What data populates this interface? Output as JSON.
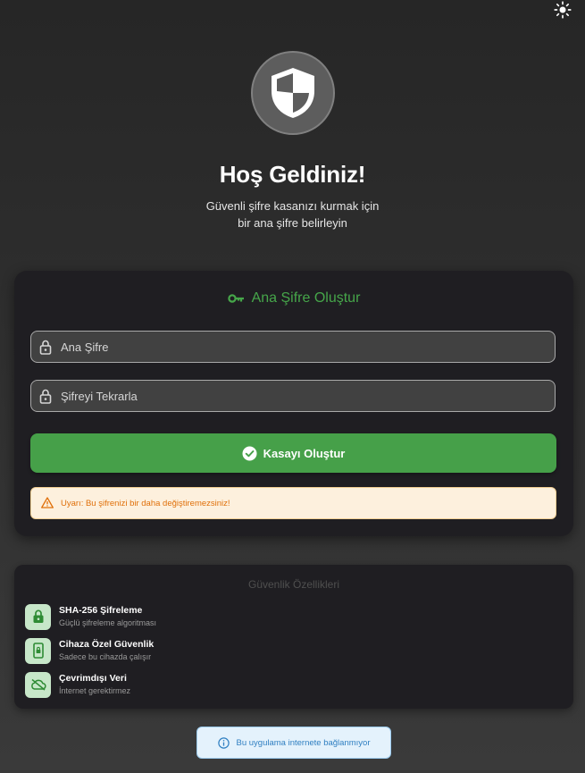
{
  "header": {
    "theme_toggle_icon": "sun-icon"
  },
  "hero": {
    "icon": "shield-icon",
    "title": "Hoş Geldiniz!",
    "subtitle_line1": "Güvenli şifre kasanızı kurmak için",
    "subtitle_line2": "bir ana şifre belirleyin"
  },
  "setup_card": {
    "title_icon": "key-icon",
    "title": "Ana Şifre Oluştur",
    "master_password": {
      "placeholder": "Ana Şifre",
      "value": "",
      "icon": "lock-icon"
    },
    "confirm_password": {
      "placeholder": "Şifreyi Tekrarla",
      "value": "",
      "icon": "lock-icon"
    },
    "create_button": {
      "label": "Kasayı Oluştur",
      "icon": "check-circle-icon"
    },
    "warning": {
      "icon": "warning-icon",
      "text": "Uyarı: Bu şifrenizi bir daha değiştiremezsiniz!"
    }
  },
  "features": {
    "title": "Güvenlik Özellikleri",
    "items": [
      {
        "icon": "lock-icon",
        "title": "SHA-256 Şifreleme",
        "description": "Güçlü şifreleme algoritması"
      },
      {
        "icon": "phone-lock-icon",
        "title": "Cihaza Özel Güvenlik",
        "description": "Sadece bu cihazda çalışır"
      },
      {
        "icon": "cloud-off-icon",
        "title": "Çevrimdışı Veri",
        "description": "İnternet gerektirmez"
      }
    ]
  },
  "offline_notice": {
    "icon": "info-icon",
    "text": "Bu uygulama internete bağlanmıyor"
  },
  "colors": {
    "accent_green": "#46a049",
    "warning_orange": "#e0700a",
    "info_blue": "#2f7fc1",
    "card_background": "#1f1e22"
  }
}
